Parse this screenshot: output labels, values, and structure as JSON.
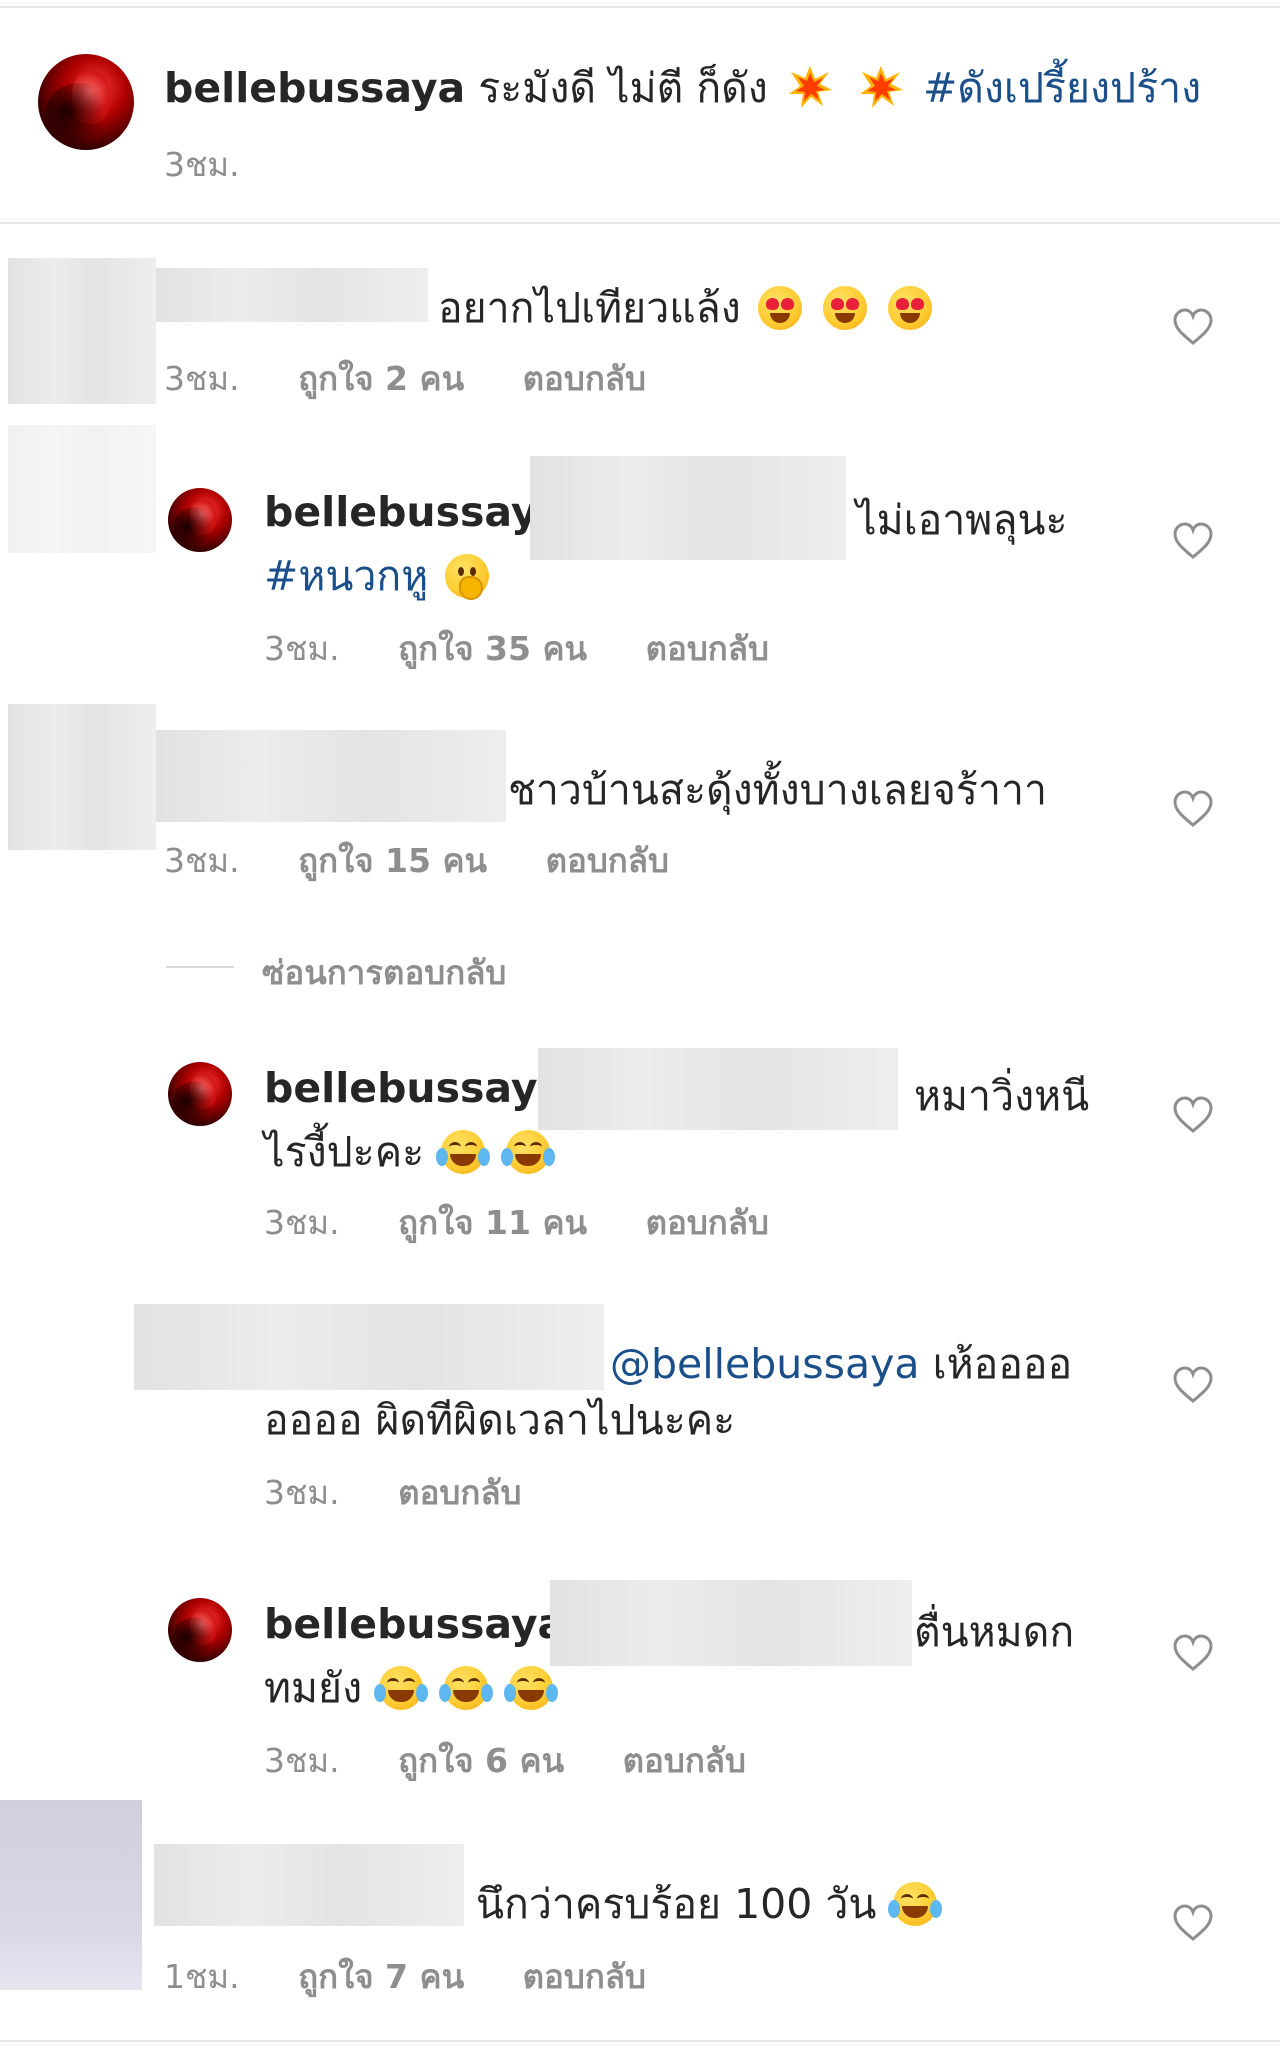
{
  "post": {
    "username": "bellebussaya",
    "caption": "ระมังดี ไม่ตี ก็ดัง",
    "hashtag": "#ดังเปรี้ยงปร้าง",
    "time": "3ชม."
  },
  "comments": [
    {
      "text": "อยากไปเทียวแล้ง",
      "time": "3ชม.",
      "likes": "ถูกใจ 2 คน",
      "reply": "ตอบกลับ",
      "emoji": [
        "heart-eyes",
        "heart-eyes",
        "heart-eyes"
      ]
    },
    {
      "username": "bellebussaya",
      "text_line1": "ไม่เอาพลุนะ",
      "hashtag": "#หนวกหู",
      "time": "3ชม.",
      "likes": "ถูกใจ 35 คน",
      "reply": "ตอบกลับ",
      "emoji": [
        "shushing-face"
      ]
    },
    {
      "text": "ชาวบ้านสะดุ้งทั้งบางเลยจร้าาา",
      "time": "3ชม.",
      "likes": "ถูกใจ 15 คน",
      "reply": "ตอบกลับ"
    },
    {
      "username": "bellebussaya",
      "text_line1": "หมาวิ่งหนี",
      "text_line2": "ไรงี้ปะคะ",
      "time": "3ชม.",
      "likes": "ถูกใจ 11 คน",
      "reply": "ตอบกลับ",
      "emoji": [
        "tears-of-joy",
        "tears-of-joy"
      ]
    },
    {
      "mention": "@bellebussaya",
      "text_line1": "เห้ออออ",
      "text_line2": "ออออ ผิดทีผิดเวลาไปนะคะ",
      "time": "3ชม.",
      "reply": "ตอบกลับ"
    },
    {
      "username": "bellebussaya",
      "text_line1": "ตื่นหมดก",
      "text_line2": "ทมยัง",
      "time": "3ชม.",
      "likes": "ถูกใจ 6 คน",
      "reply": "ตอบกลับ",
      "emoji": [
        "tears-of-joy",
        "tears-of-joy",
        "tears-of-joy"
      ]
    },
    {
      "text": "นึกว่าครบร้อย 100 วัน",
      "time": "1ชม.",
      "likes": "ถูกใจ 7 คน",
      "reply": "ตอบกลับ",
      "emoji": [
        "tears-of-joy"
      ]
    }
  ],
  "hide_replies": "ซ่อนการตอบกลับ",
  "colors": {
    "text": "#262626",
    "meta": "#8e8e8e",
    "link": "#1b4f8a",
    "divider": "#e6e6e6"
  },
  "icons": [
    "heart-outline-icon",
    "collision-icon"
  ]
}
